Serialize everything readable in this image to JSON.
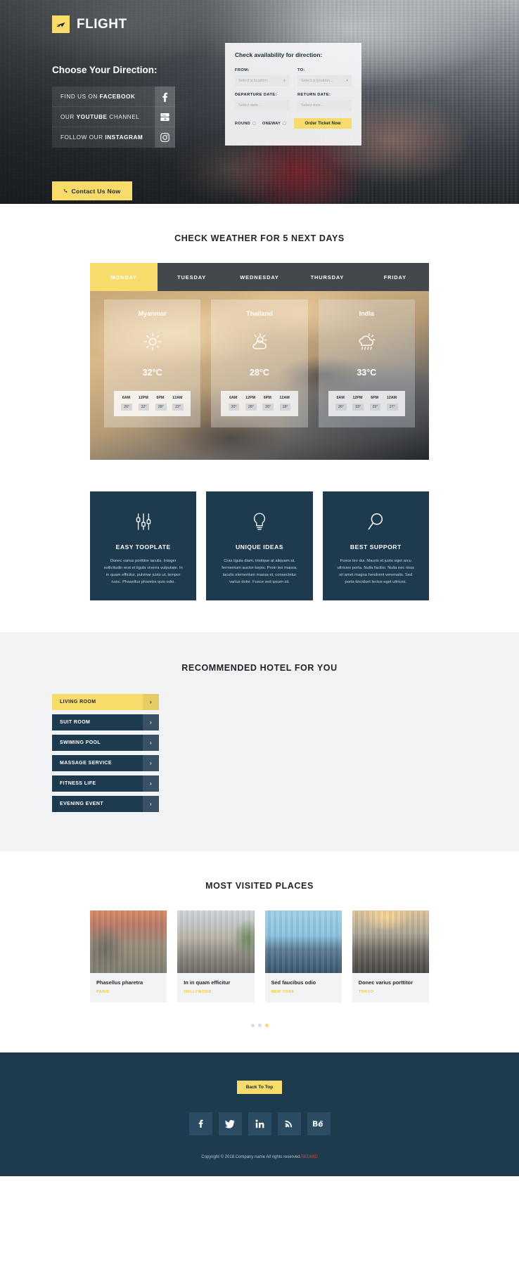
{
  "brand": {
    "name": "FLIGHT",
    "logo_icon": "airplane-icon",
    "accent": "#f7dc6b",
    "dark": "#1e3a4f"
  },
  "hero": {
    "choose_title": "Choose Your Direction:",
    "socials": [
      {
        "prefix": "FIND US ON ",
        "bold": "FACEBOOK",
        "suffix": "",
        "icon": "facebook-icon"
      },
      {
        "prefix": "OUR ",
        "bold": "YOUTUBE",
        "suffix": " CHANNEL",
        "icon": "youtube-icon"
      },
      {
        "prefix": "FOLLOW OUR ",
        "bold": "INSTAGRAM",
        "suffix": "",
        "icon": "instagram-icon"
      }
    ],
    "contact_button": "Contact Us Now",
    "contact_icon": "phone-icon"
  },
  "booking": {
    "title": "Check availability for direction:",
    "from_label": "FROM:",
    "from_placeholder": "Select a location...",
    "to_label": "TO:",
    "to_placeholder": "Select a location...",
    "departure_label": "DEPARTURE DATE:",
    "departure_placeholder": "Select date...",
    "return_label": "RETURN DATE:",
    "return_placeholder": "Select date...",
    "trip_round": "ROUND",
    "trip_oneway": "ONEWAY",
    "order_button": "Order Ticket Now"
  },
  "weather": {
    "title": "CHECK WEATHER FOR 5 NEXT DAYS",
    "tabs": [
      {
        "label": "MONDAY",
        "active": true
      },
      {
        "label": "TUESDAY",
        "active": false
      },
      {
        "label": "WEDNESDAY",
        "active": false
      },
      {
        "label": "THURSDAY",
        "active": false
      },
      {
        "label": "FRIDAY",
        "active": false
      }
    ],
    "hours": [
      "6AM",
      "12PM",
      "6PM",
      "12AM"
    ],
    "cards": [
      {
        "city": "Myanmar",
        "icon": "sun-icon",
        "temp": "32°C",
        "hourly": [
          "26°",
          "32°",
          "28°",
          "22°"
        ]
      },
      {
        "city": "Thailand",
        "icon": "sun-cloud-icon",
        "temp": "28°C",
        "hourly": [
          "20°",
          "28°",
          "26°",
          "18°"
        ]
      },
      {
        "city": "India",
        "icon": "rain-cloud-icon",
        "temp": "33°C",
        "hourly": [
          "26°",
          "33°",
          "29°",
          "27°"
        ]
      }
    ]
  },
  "features": [
    {
      "icon": "sliders-icon",
      "title": "EASY TOOPLATE",
      "text": "Donec varius porttitor iaculis. Integer sollicitudin erat et ligula viverra vulputate. In in quam efficitur, pulvinar justo ut, tempor nunc. Phasellus pharetra quis odio."
    },
    {
      "icon": "lightbulb-icon",
      "title": "UNIQUE IDEAS",
      "text": "Cras ligula diam, tristique at aliquam at, fermentum auctor turpis. Proin leo massa, iaculis elementum massa et, consectetur varius dolor. Fusce sed ipsum sit."
    },
    {
      "icon": "search-icon",
      "title": "BEST SUPPORT",
      "text": "Fusce leo dui. Mauris et justo eget arcu ultricies porta. Nulla facilisi. Nulla nec risus sit amet magna hendrerit venenatis. Sed porta tincidunt lectus eget ultrices."
    }
  ],
  "hotel": {
    "title": "RECOMMENDED HOTEL FOR YOU",
    "items": [
      {
        "label": "LIVING ROOM",
        "active": true
      },
      {
        "label": "SUIT ROOM",
        "active": false
      },
      {
        "label": "SWIMING POOL",
        "active": false
      },
      {
        "label": "MASSAGE SERVICE",
        "active": false
      },
      {
        "label": "FITNESS LIFE",
        "active": false
      },
      {
        "label": "EVENING EVENT",
        "active": false
      }
    ],
    "chevron_icon": "chevron-right-icon"
  },
  "places": {
    "title": "MOST VISITED PLACES",
    "cards": [
      {
        "title": "Phasellus pharetra",
        "city": "PARIS"
      },
      {
        "title": "In in quam efficitur",
        "city": "HOLLYWOOD"
      },
      {
        "title": "Sed faucibus odio",
        "city": "NEW YORK"
      },
      {
        "title": "Donec varius porttitor",
        "city": "TOKYO"
      }
    ],
    "dots": [
      false,
      false,
      true
    ]
  },
  "footer": {
    "back_to_top": "Back To Top",
    "socials": [
      {
        "icon": "facebook-icon",
        "glyph": "f"
      },
      {
        "icon": "twitter-icon",
        "glyph": "t"
      },
      {
        "icon": "linkedin-icon",
        "glyph": "in"
      },
      {
        "icon": "rss-icon",
        "glyph": "rss"
      },
      {
        "icon": "behance-icon",
        "glyph": "Bē"
      }
    ],
    "copyright_prefix": "Copyright © 2018.Company name All rights reserved.",
    "copyright_link": "REDMID"
  }
}
